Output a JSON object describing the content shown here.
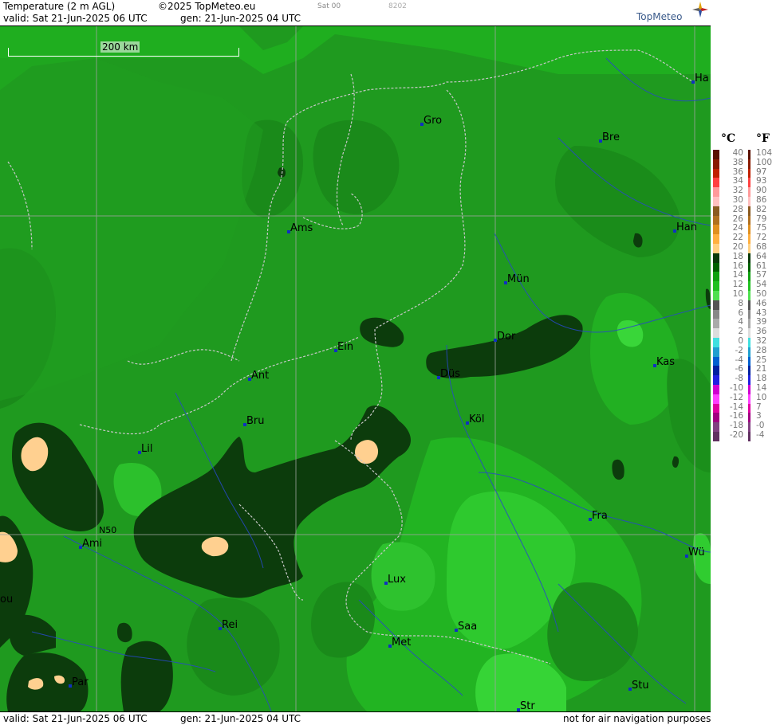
{
  "header": {
    "title": "Temperature (2 m AGL)",
    "copyright": "©2025 TopMeteo.eu",
    "day_code": "Sat 00",
    "code": "8202",
    "valid": "valid:  Sat  21-Jun-2025  06 UTC",
    "gen": "gen:  21-Jun-2025 04 UTC",
    "logo": "TopMeteo"
  },
  "footer": {
    "valid": "valid:  Sat  21-Jun-2025  06 UTC",
    "gen": "gen:  21-Jun-2025 04 UTC",
    "note": "not for air navigation purposes"
  },
  "map": {
    "scale_label": "200 km",
    "lat_label": "N50",
    "cities": [
      {
        "name": "Ha"
      },
      {
        "name": "Gro"
      },
      {
        "name": "Bre"
      },
      {
        "name": "Ams"
      },
      {
        "name": "Han"
      },
      {
        "name": "Mün"
      },
      {
        "name": "Dor"
      },
      {
        "name": "Ein"
      },
      {
        "name": "Kas"
      },
      {
        "name": "Ant"
      },
      {
        "name": "Düs"
      },
      {
        "name": "Bru"
      },
      {
        "name": "Köl"
      },
      {
        "name": "Lil"
      },
      {
        "name": "Fra"
      },
      {
        "name": "Ami"
      },
      {
        "name": "Wü"
      },
      {
        "name": "Lux"
      },
      {
        "name": "ou"
      },
      {
        "name": "Rei"
      },
      {
        "name": "Saa"
      },
      {
        "name": "Met"
      },
      {
        "name": "Stu"
      },
      {
        "name": "Par"
      },
      {
        "name": "Str"
      }
    ]
  },
  "legend": {
    "unit_c": "°C",
    "unit_f": "°F",
    "celsius": [
      "40",
      "38",
      "36",
      "34",
      "32",
      "30",
      "28",
      "26",
      "24",
      "22",
      "20",
      "18",
      "16",
      "14",
      "12",
      "10",
      "8",
      "6",
      "4",
      "2",
      "0",
      "-2",
      "-4",
      "-6",
      "-8",
      "-10",
      "-12",
      "-14",
      "-16",
      "-18",
      "-20"
    ],
    "fahrenheit": [
      "104",
      "100",
      "97",
      "93",
      "90",
      "86",
      "82",
      "79",
      "75",
      "72",
      "68",
      "64",
      "61",
      "57",
      "54",
      "50",
      "46",
      "43",
      "39",
      "36",
      "32",
      "28",
      "25",
      "21",
      "18",
      "14",
      "10",
      "7",
      "3",
      "-0",
      "-4"
    ],
    "colors": [
      "#5a1000",
      "#8a1a00",
      "#c02000",
      "#ff4040",
      "#ff9a9a",
      "#ffc0c0",
      "#8a5a20",
      "#b07020",
      "#e09020",
      "#ffb040",
      "#ffd080",
      "#0a3a0a",
      "#006000",
      "#10a010",
      "#20c020",
      "#50e050",
      "#555555",
      "#888888",
      "#aaaaaa",
      "#dddddd",
      "#40e0e0",
      "#20a0d0",
      "#0060d0",
      "#0020a0",
      "#2020e0",
      "#d000d0",
      "#ff40ff",
      "#e000a0",
      "#a00080",
      "#804080",
      "#603060"
    ]
  }
}
